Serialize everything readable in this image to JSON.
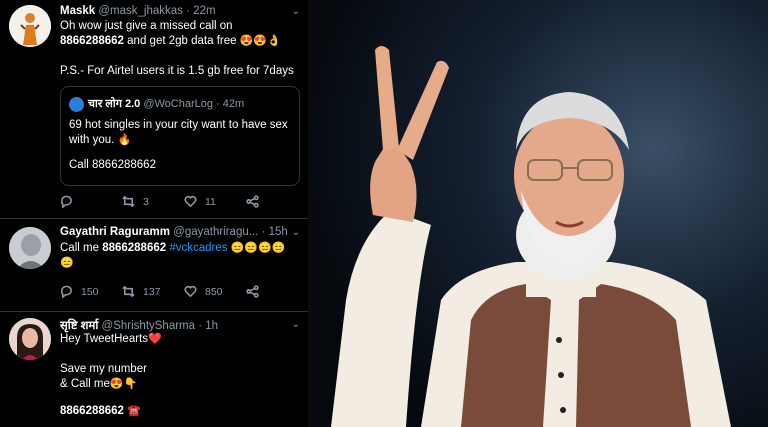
{
  "tweets": [
    {
      "name": "Maskk",
      "handle": "@mask_jhakkas",
      "time": "22m",
      "line1": "Oh wow just give a missed call on",
      "phone": "8866288662",
      "line2_rest": " and get 2gb data free",
      "line2_emoji": "😍😍👌",
      "line3": "P.S.- For Airtel users it is 1.5 gb free for 7days",
      "quote": {
        "name": "चार लोग 2.0",
        "handle": "@WoCharLog",
        "time": "42m",
        "text": "69 hot singles in your city want to have sex with you.",
        "emoji": "🔥",
        "call": "Call 8866288662"
      },
      "retweets": "3",
      "likes": "11"
    },
    {
      "name": "Gayathri Raguramm",
      "handle": "@gayathriragu...",
      "time": "15h",
      "text_prefix": "Call me ",
      "phone": "8866288662",
      "hashtag": "#vckcadres",
      "emoji1": "😑😑😑😑",
      "emoji2": "😑",
      "replies": "150",
      "retweets": "137",
      "likes": "850"
    },
    {
      "name": "सृष्टि शर्मा",
      "handle": "@ShrishtySharma",
      "time": "1h",
      "line1": "Hey TweetHearts",
      "line1_emoji": "❤️",
      "line2": "Save my number",
      "line3": "& Call me",
      "line3_emoji": "😍👇",
      "phone": "8866288662",
      "phone_emoji": "☎️"
    }
  ],
  "separator": " · "
}
